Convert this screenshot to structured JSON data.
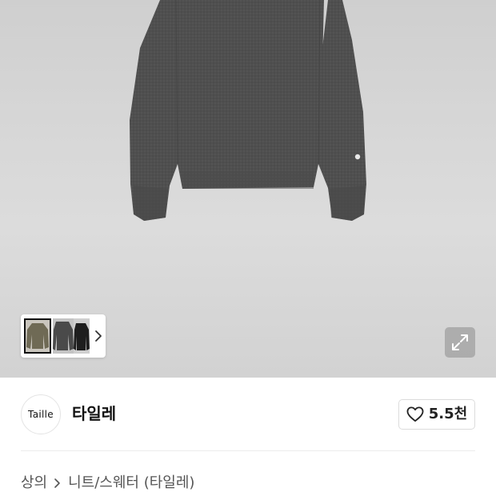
{
  "hero": {
    "thumbnails": [
      {
        "icon": "sweater-thumbnail-olive",
        "color": "#6f6a55"
      },
      {
        "icon": "sweater-thumbnail-charcoal",
        "color": "#4a4a4a"
      },
      {
        "icon": "sweater-thumbnail-black",
        "color": "#1e1e1e"
      }
    ],
    "next_icon": "chevron-right-icon",
    "expand_icon": "expand-icon"
  },
  "brand": {
    "logo_text": "Taille",
    "name": "타일레",
    "like_icon": "heart-icon",
    "like_count": "5.5천"
  },
  "breadcrumb": {
    "items": [
      "상의",
      "니트/스웨터 (타일레)"
    ],
    "separator_icon": "chevron-right-icon"
  },
  "colors": {
    "sweater": "#4e4e4e",
    "background_gray": "#d6d6d6",
    "text_primary": "#111111",
    "text_secondary": "#555555"
  }
}
